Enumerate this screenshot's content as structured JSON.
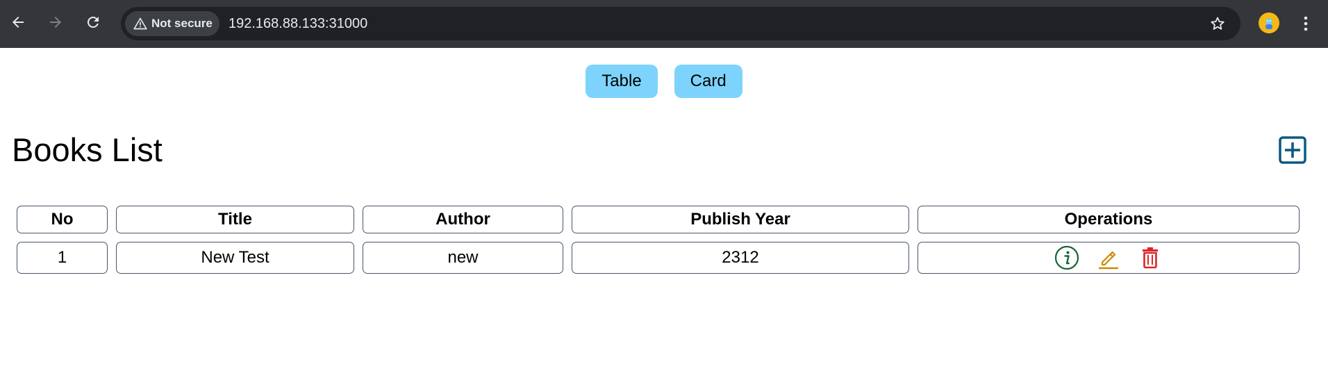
{
  "browser": {
    "security_label": "Not secure",
    "url": "192.168.88.133:31000",
    "icons": [
      "back-icon",
      "forward-icon",
      "reload-icon",
      "warning-icon",
      "star-icon",
      "profile-avatar",
      "menu-icon"
    ]
  },
  "view_toggle": {
    "table_label": "Table",
    "card_label": "Card"
  },
  "page": {
    "title": "Books List",
    "add_icon": "plus-square-icon"
  },
  "table": {
    "headers": {
      "no": "No",
      "title": "Title",
      "author": "Author",
      "publish_year": "Publish Year",
      "operations": "Operations"
    },
    "rows": [
      {
        "no": "1",
        "title": "New Test",
        "author": "new",
        "publish_year": "2312",
        "operations": [
          "info-icon",
          "edit-icon",
          "delete-icon"
        ]
      }
    ]
  },
  "colors": {
    "toggle_bg": "#7dd3fc",
    "add_icon": "#0b5a82",
    "info_icon": "#166534",
    "edit_icon": "#ca8a04",
    "delete_icon": "#dc2626",
    "cell_border": "#475569"
  }
}
